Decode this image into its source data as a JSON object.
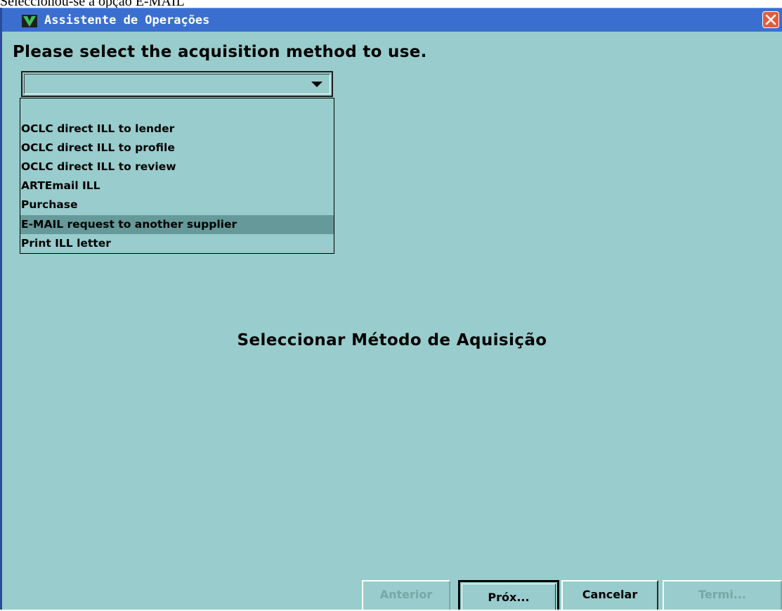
{
  "caption": "Seleccionou-se a opção E-MAIL",
  "window": {
    "title": "Assistente de Operações",
    "prompt": "Please select the acquisition method to use.",
    "combo_value": "",
    "options": [
      "",
      "OCLC direct ILL to lender",
      "OCLC direct ILL to profile",
      "OCLC direct ILL to review",
      "ARTEmail ILL",
      "Purchase",
      "E-MAIL request to another supplier",
      "Print ILL letter"
    ],
    "selected_option": "E-MAIL request to another supplier",
    "heading": "Seleccionar Método de Aquisição"
  },
  "buttons": {
    "back": "Anterior",
    "next": "Próx...",
    "cancel": "Cancelar",
    "finish": "Termi..."
  },
  "colors": {
    "window_bg": "#99cccc",
    "titlebar": "#3a6fd0",
    "selection": "#669999",
    "close_button": "#e45b3a"
  },
  "icons": {
    "app": "green-v-logo-icon",
    "close": "close-x-icon",
    "dropdown": "triangle-down-icon"
  }
}
